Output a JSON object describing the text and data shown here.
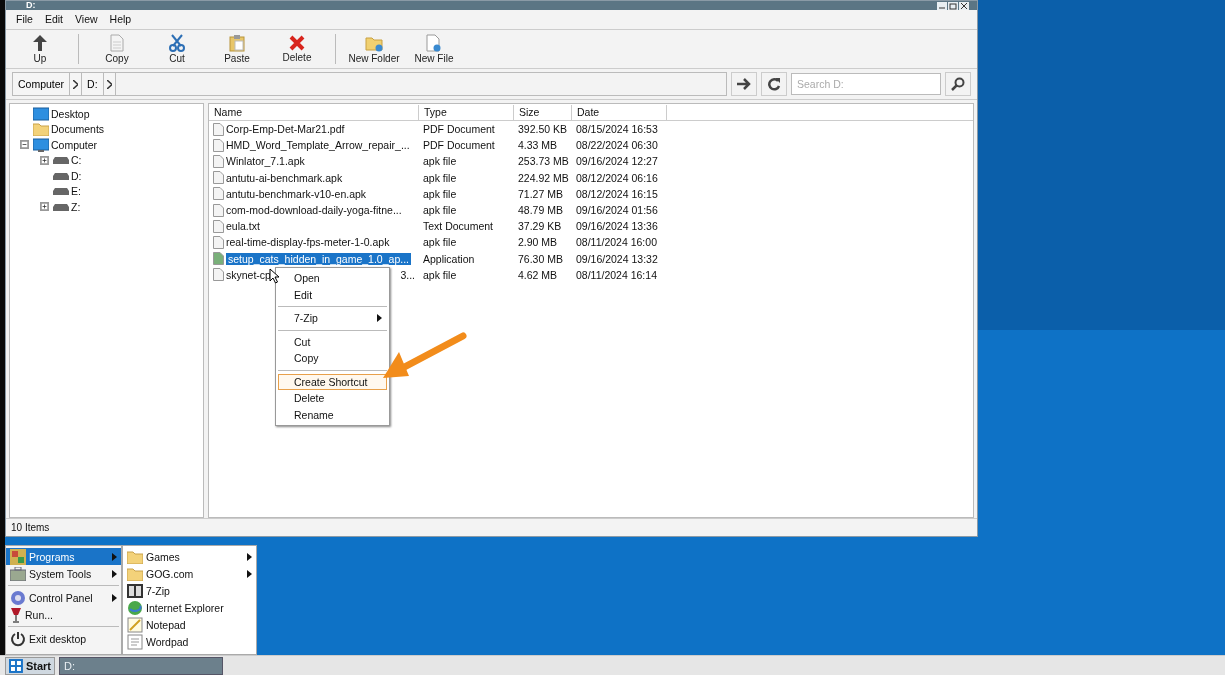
{
  "window": {
    "title": "D:",
    "menu": [
      "File",
      "Edit",
      "View",
      "Help"
    ],
    "toolbar": [
      [
        {
          "label": "Up",
          "kind": "up"
        }
      ],
      [
        {
          "label": "Copy",
          "kind": "copy"
        },
        {
          "label": "Cut",
          "kind": "cut"
        },
        {
          "label": "Paste",
          "kind": "paste"
        },
        {
          "label": "Delete",
          "kind": "delete"
        }
      ],
      [
        {
          "label": "New Folder",
          "kind": "new-folder"
        },
        {
          "label": "New File",
          "kind": "new-file"
        }
      ]
    ],
    "breadcrumb": [
      "Computer",
      "D:"
    ],
    "search": {
      "placeholder": "Search D:"
    },
    "tree": [
      {
        "label": "Desktop",
        "kind": "desktop"
      },
      {
        "label": "Documents",
        "kind": "folder"
      },
      {
        "label": "Computer",
        "kind": "computer",
        "expanded": true,
        "children": [
          {
            "label": "C:",
            "kind": "drive",
            "expanded": false
          },
          {
            "label": "D:",
            "kind": "drive"
          },
          {
            "label": "E:",
            "kind": "drive"
          },
          {
            "label": "Z:",
            "kind": "drive",
            "expanded": false
          }
        ]
      }
    ],
    "columns": [
      "Name",
      "Type",
      "Size",
      "Date"
    ],
    "files": [
      {
        "name": "Corp-Emp-Det-Mar21.pdf",
        "type": "PDF Document",
        "size": "392.50 KB",
        "date": "08/15/2024 16:53",
        "selected": false
      },
      {
        "name": "HMD_Word_Template_Arrow_repair_...",
        "type": "PDF Document",
        "size": "4.33 MB",
        "date": "08/22/2024 06:30",
        "selected": false
      },
      {
        "name": "Winlator_7.1.apk",
        "type": "apk file",
        "size": "253.73 MB",
        "date": "09/16/2024 12:27",
        "selected": false
      },
      {
        "name": "antutu-ai-benchmark.apk",
        "type": "apk file",
        "size": "224.92 MB",
        "date": "08/12/2024 06:16",
        "selected": false
      },
      {
        "name": "antutu-benchmark-v10-en.apk",
        "type": "apk file",
        "size": "71.27 MB",
        "date": "08/12/2024 16:15",
        "selected": false
      },
      {
        "name": "com-mod-download-daily-yoga-fitne...",
        "type": "apk file",
        "size": "48.79 MB",
        "date": "09/16/2024 01:56",
        "selected": false
      },
      {
        "name": "eula.txt",
        "type": "Text Document",
        "size": "37.29 KB",
        "date": "09/16/2024 13:36",
        "selected": false
      },
      {
        "name": "real-time-display-fps-meter-1-0.apk",
        "type": "apk file",
        "size": "2.90 MB",
        "date": "08/11/2024 16:00",
        "selected": false
      },
      {
        "name": "setup_cats_hidden_in_game_1.0_ap...",
        "type": "Application",
        "size": "76.30 MB",
        "date": "09/16/2024 13:32",
        "selected": true
      },
      {
        "name": "skynet-cp",
        "name_tail": "3...",
        "type": "apk file",
        "size": "4.62 MB",
        "date": "08/11/2024 16:14",
        "selected": false
      }
    ],
    "context_menu": [
      [
        {
          "label": "Open",
          "submenu": false,
          "selected": false
        },
        {
          "label": "Edit",
          "submenu": false,
          "selected": false
        }
      ],
      [
        {
          "label": "7-Zip",
          "submenu": true,
          "selected": false
        }
      ],
      [
        {
          "label": "Cut",
          "submenu": false,
          "selected": false
        },
        {
          "label": "Copy",
          "submenu": false,
          "selected": false
        }
      ],
      [
        {
          "label": "Create Shortcut",
          "submenu": false,
          "selected": true
        },
        {
          "label": "Delete",
          "submenu": false,
          "selected": false
        },
        {
          "label": "Rename",
          "submenu": false,
          "selected": false
        }
      ]
    ],
    "status_bar": "10 Items"
  },
  "start_menu": {
    "items": [
      [
        {
          "label": "Programs",
          "kind": "programs",
          "submenu": true,
          "selected": true
        },
        {
          "label": "System Tools",
          "kind": "tools",
          "submenu": true,
          "selected": false
        }
      ],
      [
        {
          "label": "Control Panel",
          "kind": "gear",
          "submenu": true,
          "selected": false
        },
        {
          "label": "Run...",
          "kind": "run",
          "submenu": false,
          "selected": false
        }
      ],
      [
        {
          "label": "Exit desktop",
          "kind": "power",
          "submenu": false,
          "selected": false
        }
      ]
    ],
    "programs": [
      {
        "label": "Games",
        "kind": "folder",
        "submenu": true
      },
      {
        "label": "GOG.com",
        "kind": "folder",
        "submenu": true
      },
      {
        "label": "7-Zip",
        "kind": "zip",
        "submenu": false
      },
      {
        "label": "Internet Explorer",
        "kind": "globe",
        "submenu": false
      },
      {
        "label": "Notepad",
        "kind": "notepad",
        "submenu": false
      },
      {
        "label": "Wordpad",
        "kind": "wordpad",
        "submenu": false
      }
    ]
  },
  "taskbar": {
    "start": "Start",
    "tasks": [
      "D:"
    ]
  }
}
